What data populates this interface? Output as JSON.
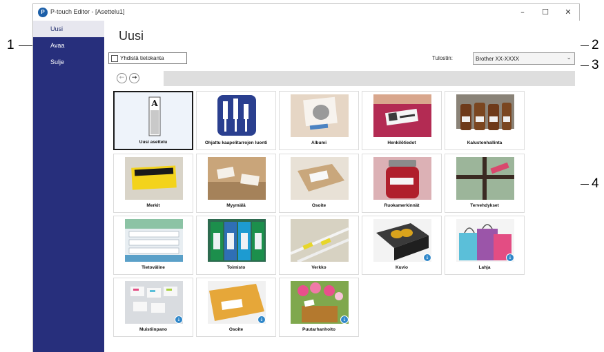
{
  "window": {
    "title": "P-touch Editor - [Asettelu1]",
    "controls": {
      "minimize": "–",
      "maximize": "☐",
      "close": "✕"
    }
  },
  "callouts": [
    "1",
    "2",
    "3",
    "4"
  ],
  "sidebar": {
    "items": [
      {
        "label": "Uusi",
        "active": true
      },
      {
        "label": "Avaa",
        "active": false
      },
      {
        "label": "Sulje",
        "active": false
      }
    ]
  },
  "main": {
    "title": "Uusi",
    "database_checkbox_label": "Yhdistä tietokanta",
    "database_checked": false,
    "printer_label": "Tulostin:",
    "printer_value": "Brother XX-XXXX",
    "nav": {
      "back": "←",
      "forward": "→",
      "path": ""
    }
  },
  "templates": [
    {
      "label": "Uusi asettelu",
      "icon": "new-layout-icon",
      "selected": true,
      "download": false
    },
    {
      "label": "Ohjattu kaapelitarrojen luonti",
      "icon": "cable-label-wizard-icon",
      "selected": false,
      "download": false
    },
    {
      "label": "Albumi",
      "icon": "album-photo",
      "selected": false,
      "download": false
    },
    {
      "label": "Henkilötiedot",
      "icon": "id-badge-photo",
      "selected": false,
      "download": false
    },
    {
      "label": "Kalustonhallinta",
      "icon": "asset-bottles-photo",
      "selected": false,
      "download": false
    },
    {
      "label": "Merkit",
      "icon": "caution-sign-photo",
      "selected": false,
      "download": false
    },
    {
      "label": "Myymälä",
      "icon": "store-photo",
      "selected": false,
      "download": false
    },
    {
      "label": "Osoite",
      "icon": "address-box-photo",
      "selected": false,
      "download": false
    },
    {
      "label": "Ruokamerkinnät",
      "icon": "food-jar-photo",
      "selected": false,
      "download": false
    },
    {
      "label": "Tervehdykset",
      "icon": "gift-ribbon-photo",
      "selected": false,
      "download": false
    },
    {
      "label": "Tietoväline",
      "icon": "media-discs-photo",
      "selected": false,
      "download": false
    },
    {
      "label": "Toimisto",
      "icon": "office-binders-photo",
      "selected": false,
      "download": false
    },
    {
      "label": "Verkko",
      "icon": "network-cables-photo",
      "selected": false,
      "download": false
    },
    {
      "label": "Kuvio",
      "icon": "butterfly-box-photo",
      "selected": false,
      "download": true
    },
    {
      "label": "Lahja",
      "icon": "gift-bags-photo",
      "selected": false,
      "download": true
    },
    {
      "label": "Muistiinpano",
      "icon": "sticky-notes-photo",
      "selected": false,
      "download": true
    },
    {
      "label": "Osoite",
      "icon": "envelope-photo",
      "selected": false,
      "download": true
    },
    {
      "label": "Puutarhanhoito",
      "icon": "flower-pots-photo",
      "selected": false,
      "download": true
    }
  ],
  "colors": {
    "sidebar_bg": "#272f7c",
    "selected_tile_border": "#1a1a1a",
    "download_badge": "#2f87c9"
  }
}
